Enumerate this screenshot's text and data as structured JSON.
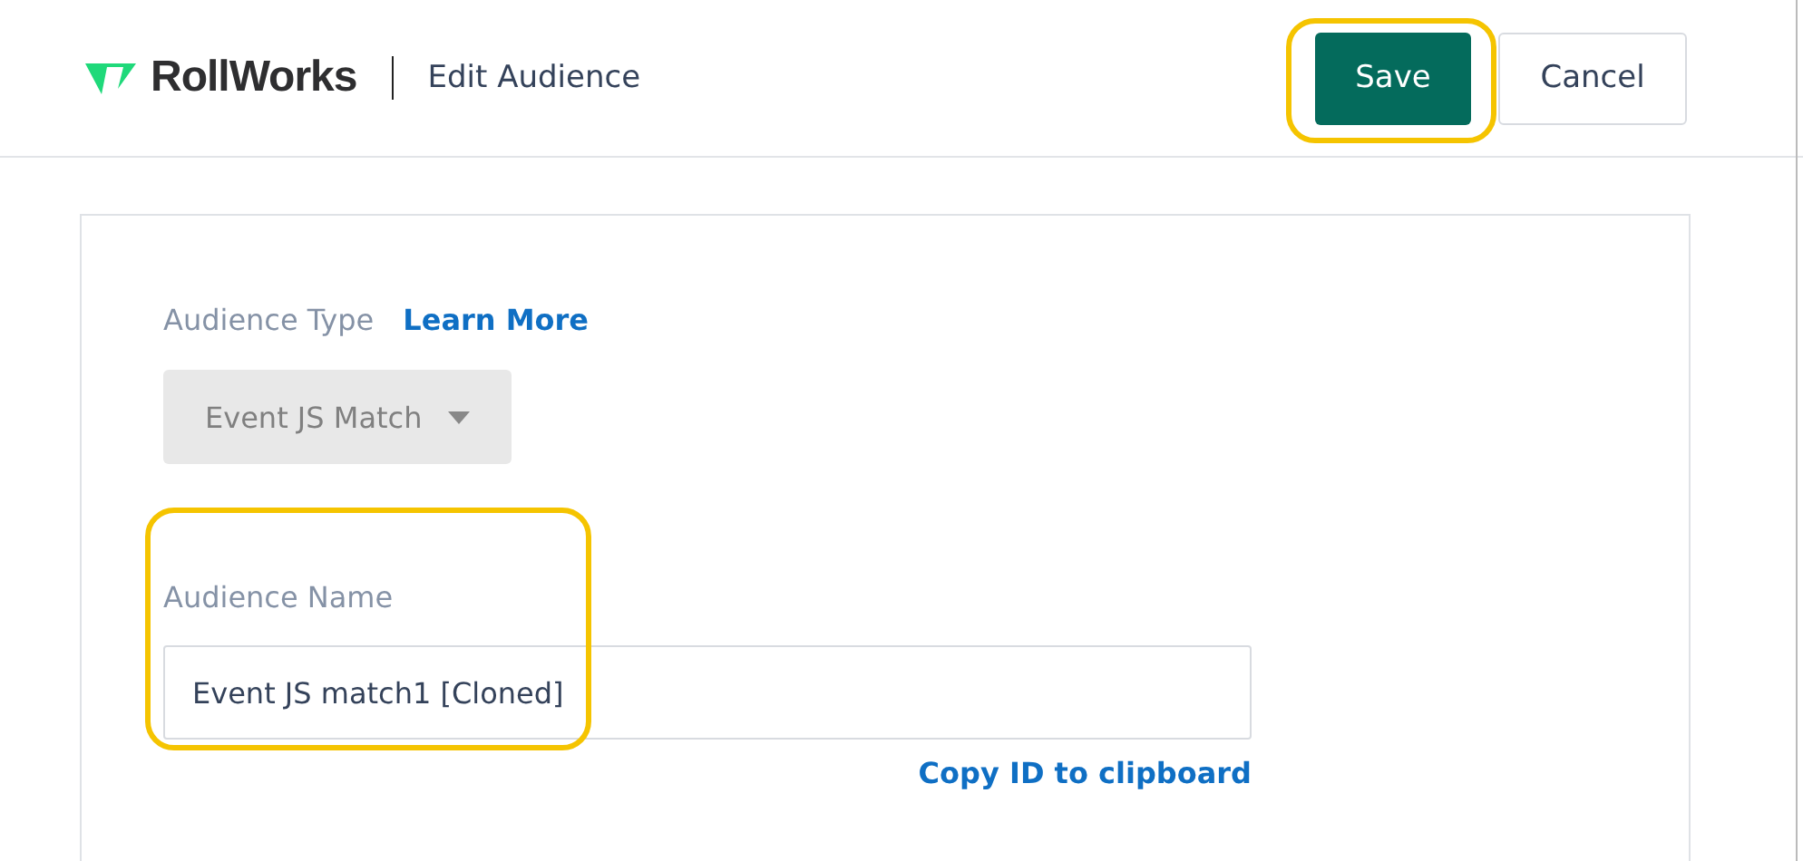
{
  "header": {
    "brand": "RollWorks",
    "title": "Edit Audience",
    "buttons": [
      {
        "label": "Save",
        "kind": "primary",
        "highlighted": true
      },
      {
        "label": "Cancel",
        "kind": "secondary",
        "highlighted": false
      }
    ]
  },
  "form": {
    "type_label": "Audience Type",
    "learn_more": "Learn More",
    "type_select": {
      "value": "Event JS Match",
      "disabled": true
    },
    "name_label": "Audience Name",
    "name_field": {
      "value": "Event JS match1 [Cloned]",
      "highlighted": true
    },
    "copy_link": "Copy ID to clipboard"
  }
}
